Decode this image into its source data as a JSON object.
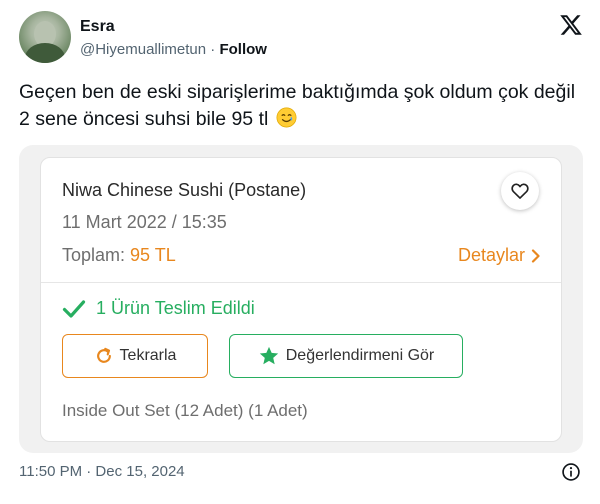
{
  "tweet": {
    "author_name": "Esra",
    "handle": "@Hiyemuallimetun",
    "separator": " · ",
    "follow_label": "Follow",
    "text": "Geçen ben de eski siparişlerime baktığımda şok oldum çok değil 2 sene öncesi suhsi bile 95 tl",
    "timestamp": "11:50 PM · Dec 15, 2024"
  },
  "order_card": {
    "restaurant": "Niwa Chinese Sushi (Postane)",
    "date": "11 Mart 2022 / 15:35",
    "total_label": "Toplam:",
    "total_amount": "95 TL",
    "details_label": "Detaylar",
    "delivered_label": "1 Ürün Teslim Edildi",
    "repeat_button": "Tekrarla",
    "review_button": "Değerlendirmeni Gör",
    "items": "Inside Out Set (12 Adet) (1 Adet)"
  },
  "icons": {
    "logo": "x-logo-icon",
    "emoji": "smiling-face-with-tear-icon",
    "heart": "heart-outline-icon",
    "chevron": "chevron-right-icon",
    "check": "checkmark-icon",
    "repeat": "refresh-icon",
    "star": "star-icon",
    "info": "info-icon"
  },
  "colors": {
    "accent_orange": "#e8871e",
    "accent_green": "#27ae60",
    "text_primary": "#0f1419",
    "text_secondary": "#536471"
  }
}
